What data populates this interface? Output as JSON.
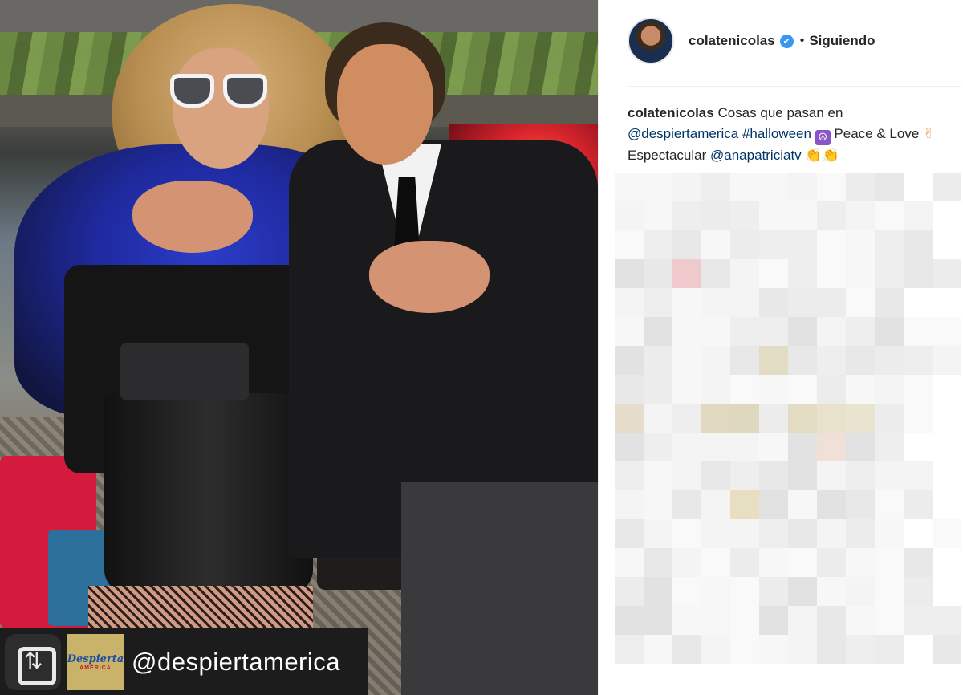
{
  "post": {
    "username": "colatenicolas",
    "separator": "•",
    "follow_status": "Siguiendo",
    "caption": {
      "user": "colatenicolas",
      "text_1": "Cosas que pasan en",
      "mention_1": "@despiertamerica",
      "hashtag": "#halloween",
      "peace_emoji": "☮",
      "text_2": "Peace &",
      "text_3": "Love",
      "hand_emoji": "✌",
      "text_4": "Espectacular",
      "mention_2": "@anapatriciatv",
      "clap_emoji": "👏👏"
    }
  },
  "photo": {
    "repost_handle": "@despiertamerica",
    "brand_logo_line1": "Despierta",
    "brand_logo_line2": "AMÉRICA"
  },
  "icons": {
    "verified": "verified-badge-icon",
    "repost": "repost-app-icon"
  },
  "colors": {
    "link": "#003569",
    "verified": "#3897f0",
    "text": "#262626"
  }
}
